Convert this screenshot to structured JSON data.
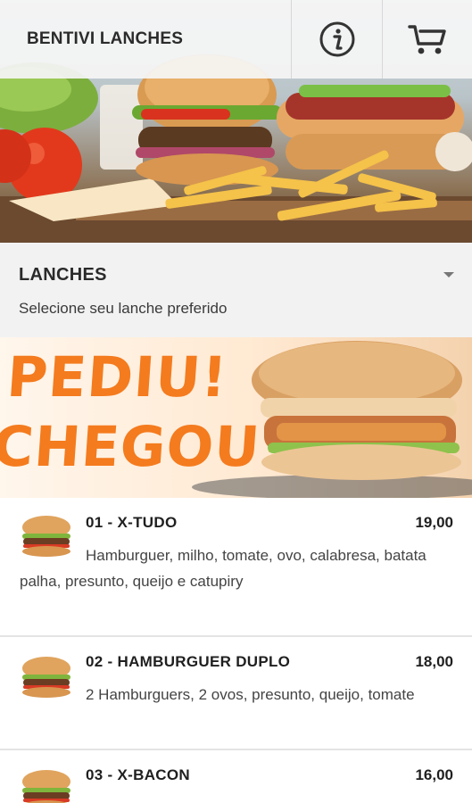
{
  "header": {
    "title": "BENTIVI LANCHES",
    "info_icon": "info-icon",
    "cart_icon": "cart-icon"
  },
  "hero_image": {
    "description_icon": "burger-fries-hotdog-photo"
  },
  "section": {
    "title": "LANCHES",
    "subtitle": "Selecione seu lanche preferido",
    "toggle_icon": "caret-down-icon"
  },
  "banner": {
    "line1": "PEDIU!",
    "line2": "CHEGOU!"
  },
  "menu": {
    "items": [
      {
        "name": "01 - X-TUDO",
        "price": "19,00",
        "description": "Hamburguer, milho, tomate, ovo, calabresa, batata palha, presunto, queijo e catupiry"
      },
      {
        "name": "02 - HAMBURGUER DUPLO",
        "price": "18,00",
        "description": "2 Hamburguers, 2 ovos, presunto, queijo, tomate"
      },
      {
        "name": "03 - X-BACON",
        "price": "16,00",
        "description": ""
      }
    ]
  },
  "colors": {
    "accent_orange": "#f47b1e",
    "background": "#f2f2f2",
    "card": "#ffffff"
  }
}
